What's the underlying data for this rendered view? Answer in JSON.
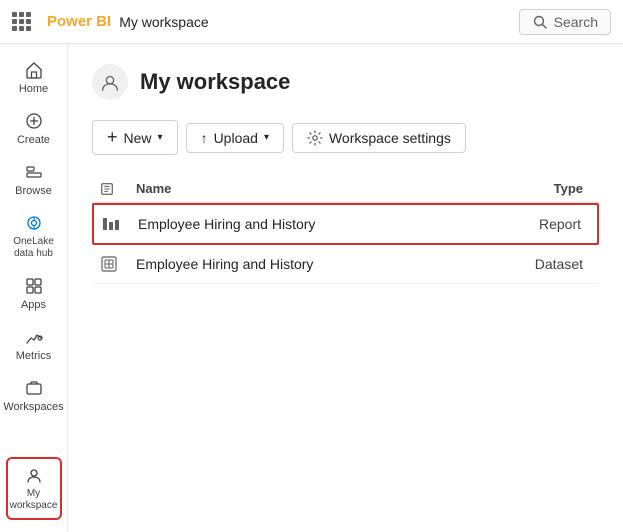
{
  "topbar": {
    "brand": "Power BI",
    "workspace_label": "My workspace",
    "search_label": "Search"
  },
  "sidebar": {
    "items": [
      {
        "id": "home",
        "label": "Home"
      },
      {
        "id": "create",
        "label": "Create"
      },
      {
        "id": "browse",
        "label": "Browse"
      },
      {
        "id": "onelake",
        "label": "OneLake data hub"
      },
      {
        "id": "apps",
        "label": "Apps"
      },
      {
        "id": "metrics",
        "label": "Metrics"
      },
      {
        "id": "workspaces",
        "label": "Workspaces"
      }
    ],
    "my_workspace_label": "My workspace"
  },
  "content": {
    "title": "My workspace",
    "toolbar": {
      "new_label": "New",
      "upload_label": "Upload",
      "settings_label": "Workspace settings"
    },
    "table": {
      "col_name": "Name",
      "col_type": "Type",
      "rows": [
        {
          "id": 1,
          "name": "Employee Hiring and History",
          "type": "Report",
          "highlighted": true
        },
        {
          "id": 2,
          "name": "Employee Hiring and History",
          "type": "Dataset",
          "highlighted": false
        }
      ]
    }
  }
}
